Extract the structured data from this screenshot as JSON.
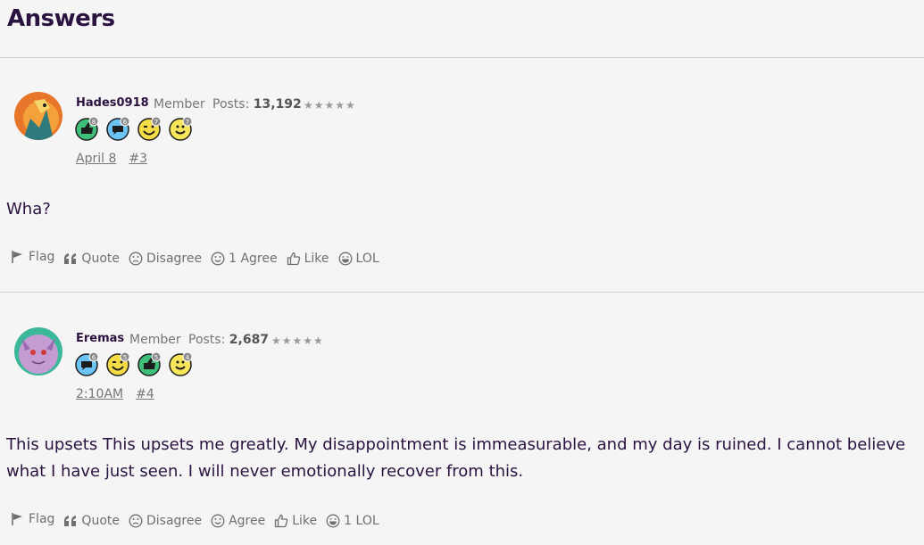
{
  "page": {
    "title": "Answers"
  },
  "comments": [
    {
      "author": "Hades0918",
      "role": "Member",
      "posts_label": "Posts:",
      "posts_count": "13,192",
      "stars": "★★★★★",
      "badges": [
        {
          "icon": "like-badge-icon",
          "count": "8",
          "color": "#3fbf7a"
        },
        {
          "icon": "comment-badge-icon",
          "count": "6",
          "color": "#6cc4f5"
        },
        {
          "icon": "wink-badge-icon",
          "count": "7",
          "color": "#f3dc45"
        },
        {
          "icon": "smile-badge-icon",
          "count": "7",
          "color": "#f7e65a"
        }
      ],
      "date": "April 8",
      "permalink": "#3",
      "body": "Wha?",
      "reactions": {
        "flag": "Flag",
        "quote": "Quote",
        "disagree": "Disagree",
        "agree": "1 Agree",
        "like": "Like",
        "lol": "LOL"
      }
    },
    {
      "author": "Eremas",
      "role": "Member",
      "posts_label": "Posts:",
      "posts_count": "2,687",
      "stars": "★★★★★",
      "badges": [
        {
          "icon": "comment-badge-icon",
          "count": "6",
          "color": "#6cc4f5"
        },
        {
          "icon": "wink-badge-icon",
          "count": "5",
          "color": "#f3dc45"
        },
        {
          "icon": "like-badge-icon",
          "count": "5",
          "color": "#3fbf7a"
        },
        {
          "icon": "smile-badge-icon",
          "count": "4",
          "color": "#f7e65a"
        }
      ],
      "date": "2:10AM",
      "permalink": "#4",
      "body": "This upsets This upsets me greatly. My disappointment is immeasurable, and my day is ruined. I cannot believe what I have just seen. I will never emotionally recover from this.",
      "reactions": {
        "flag": "Flag",
        "quote": "Quote",
        "disagree": "Disagree",
        "agree": "Agree",
        "like": "Like",
        "lol": "1 LOL"
      }
    }
  ]
}
